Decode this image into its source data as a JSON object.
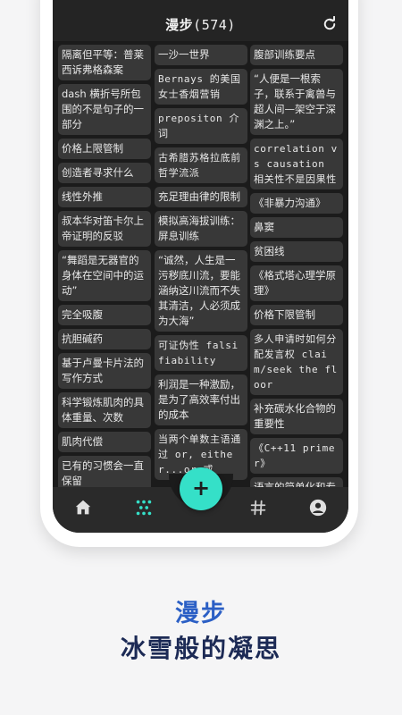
{
  "header": {
    "title": "漫步",
    "count": "(574)",
    "refresh_icon": "refresh-icon"
  },
  "columns": [
    [
      {
        "text": "隔离但平等：普莱西诉弗格森案"
      },
      {
        "text": "dash 横折号所包围的不是句子的一部分"
      },
      {
        "text": "价格上限管制"
      },
      {
        "text": "创造者寻求什么"
      },
      {
        "text": "线性外推"
      },
      {
        "text": "叔本华对笛卡尔上帝证明的反驳"
      },
      {
        "text": "“舞蹈是无器官的身体在空间中的运动”"
      },
      {
        "text": "完全吸腹"
      },
      {
        "text": "抗胆碱药"
      },
      {
        "text": "基于卢曼卡片法的写作方式"
      },
      {
        "text": "科学锻炼肌肉的具体重量、次数"
      },
      {
        "text": "肌肉代偿"
      },
      {
        "text": "已有的习惯会一直保留"
      }
    ],
    [
      {
        "text": "一沙一世界"
      },
      {
        "text": "Bernays 的美国女士香烟营销"
      },
      {
        "text": "prepositon 介词"
      },
      {
        "text": "古希腊苏格拉底前哲学流派"
      },
      {
        "text": "充足理由律的限制"
      },
      {
        "text": "模拟高海拔训练：屏息训练"
      },
      {
        "text": "“诚然，人生是一污秽底川流，要能涵纳这川流而不失其清洁，人必须成为大海”"
      },
      {
        "text": "可证伪性 falsifiability"
      },
      {
        "text": "利润是一种激励，是为了高效率付出的成本"
      },
      {
        "text": "当两个单数主语通过 or, either...or 或"
      }
    ],
    [
      {
        "text": "腹部训练要点"
      },
      {
        "text": "“人便是一根索子，联系于禽兽与超人间—架空于深渊之上。”"
      },
      {
        "text": "correlation vs causation 相关性不是因果性"
      },
      {
        "text": "《非暴力沟通》"
      },
      {
        "text": "鼻窦"
      },
      {
        "text": "贫困线"
      },
      {
        "text": "《格式塔心理学原理》"
      },
      {
        "text": "价格下限管制"
      },
      {
        "text": "多人申请时如何分配发言权 claim/seek the floor"
      },
      {
        "text": "补充碳水化合物的重要性"
      },
      {
        "text": "《C++11 primer》"
      },
      {
        "text": "语言的简单化和专"
      }
    ]
  ],
  "bottom_nav": [
    {
      "name": "home",
      "icon": "home-icon"
    },
    {
      "name": "wander",
      "icon": "dots-grid-icon"
    },
    {
      "name": "tags",
      "icon": "hash-icon"
    },
    {
      "name": "profile",
      "icon": "person-icon"
    }
  ],
  "fab": {
    "label": "+"
  },
  "slogan": {
    "line1": "漫步",
    "line2": "冰雪般的凝思"
  },
  "colors": {
    "accent": "#35e0c8",
    "slogan_blue": "#2b5fc5",
    "slogan_dark": "#1c2a55",
    "card": "#383838",
    "background": "#1b1b1b"
  }
}
